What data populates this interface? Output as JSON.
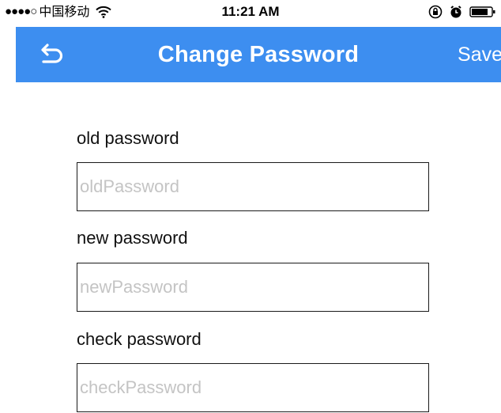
{
  "status_bar": {
    "signal_dots": "●●●●○",
    "carrier": "中国移动",
    "time": "11:21 AM"
  },
  "nav": {
    "title": "Change Password",
    "save_label": "Save"
  },
  "form": {
    "old": {
      "label": "old password",
      "placeholder": "oldPassword",
      "value": ""
    },
    "new": {
      "label": "new password",
      "placeholder": "newPassword",
      "value": ""
    },
    "check": {
      "label": "check password",
      "placeholder": "checkPassword",
      "value": ""
    }
  },
  "colors": {
    "nav_background": "#3d8ef0",
    "placeholder": "#c4c4c4"
  },
  "icons": {
    "back": "back-arrow-icon",
    "wifi": "wifi-icon",
    "orientation_lock": "orientation-lock-icon",
    "alarm": "alarm-icon",
    "battery": "battery-icon"
  }
}
